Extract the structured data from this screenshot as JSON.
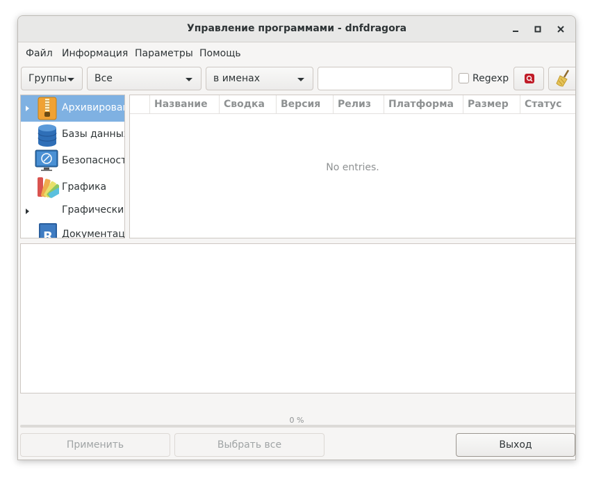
{
  "window": {
    "title": "Управление программами - dnfdragora",
    "controls": [
      "minimize-icon",
      "maximize-icon",
      "close-icon"
    ]
  },
  "menu": [
    "Файл",
    "Информация",
    "Параметры",
    "Помощь"
  ],
  "toolbar": {
    "groups_label": "Группы",
    "filter_value": "Все",
    "search_scope_value": "в именах",
    "search_value": "",
    "regexp_label": "Regexp",
    "regexp_checked": false,
    "search_icon": "search-icon",
    "clear_icon": "broom-icon"
  },
  "groups": [
    {
      "label": "Архивирование",
      "icon": "archive-icon",
      "selected": true,
      "expandable": true
    },
    {
      "label": "Базы данных",
      "icon": "database-icon",
      "selected": false,
      "expandable": false
    },
    {
      "label": "Безопасность",
      "icon": "security-icon",
      "selected": false,
      "expandable": false
    },
    {
      "label": "Графика",
      "icon": "graphics-icon",
      "selected": false,
      "expandable": false
    },
    {
      "label": "Графический",
      "icon": "",
      "selected": false,
      "expandable": true
    },
    {
      "label": "Документация",
      "icon": "documentation-icon",
      "selected": false,
      "expandable": false
    }
  ],
  "table": {
    "columns": [
      "Название",
      "Сводка",
      "Версия",
      "Релиз",
      "Платформа",
      "Размер",
      "Статус"
    ],
    "empty_text": "No entries."
  },
  "progress": {
    "text": "0 %",
    "value": 0
  },
  "buttons": {
    "apply": "Применить",
    "select_all": "Выбрать все",
    "exit": "Выход"
  },
  "colors": {
    "selection": "#7fb1e2",
    "search_button": "#c01c28",
    "progress": "#3584e4"
  }
}
